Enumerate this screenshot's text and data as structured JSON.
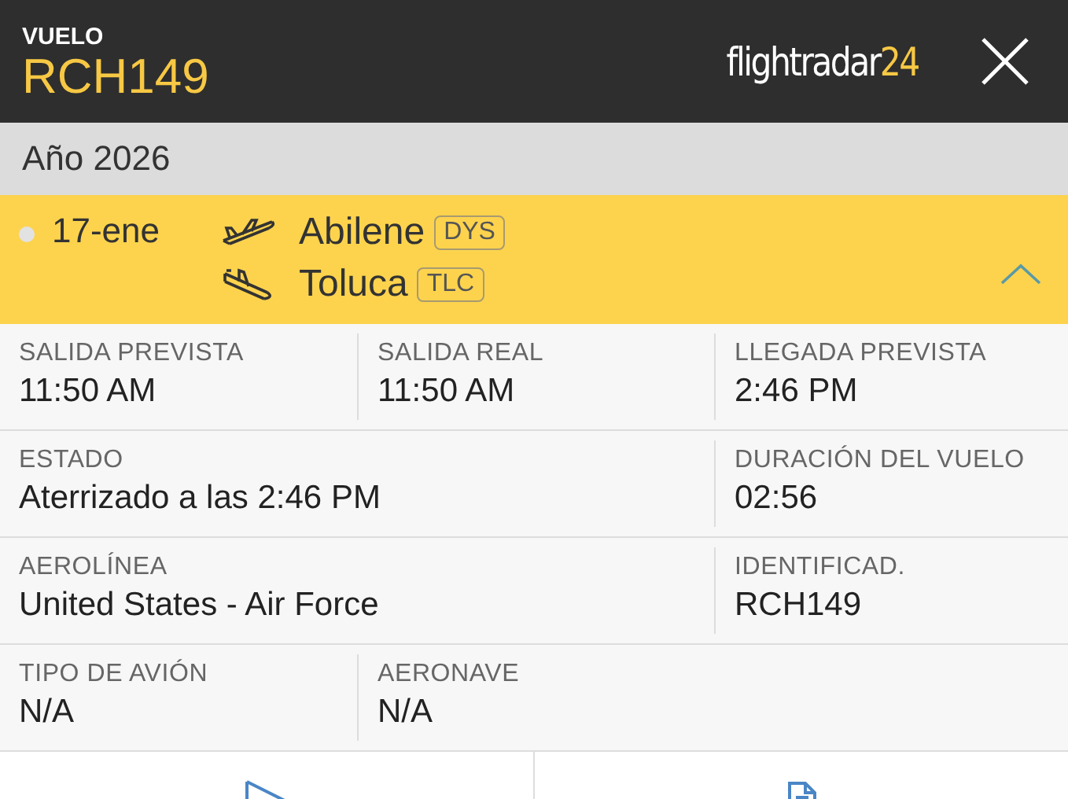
{
  "header": {
    "label": "VUELO",
    "flight": "RCH149",
    "logo_text": "flightradar",
    "logo_accent": "24"
  },
  "year_bar": "Año 2026",
  "flight_row": {
    "date": "17-ene",
    "expanded": true,
    "legs": [
      {
        "kind": "departure",
        "city": "Abilene",
        "code": "DYS"
      },
      {
        "kind": "arrival",
        "city": "Toluca",
        "code": "TLC"
      }
    ]
  },
  "details": [
    {
      "kind": "even",
      "cells": [
        {
          "label": "SALIDA PREVISTA",
          "value": "11:50 AM"
        },
        {
          "label": "SALIDA REAL",
          "value": "11:50 AM"
        },
        {
          "label": "LLEGADA PREVISTA",
          "value": "2:46 PM"
        }
      ]
    },
    {
      "kind": "wide",
      "cells": [
        {
          "label": "ESTADO",
          "value": "Aterrizado a las 2:46 PM"
        },
        {
          "label": "DURACIÓN DEL VUELO",
          "value": "02:56"
        }
      ]
    },
    {
      "kind": "wide",
      "cells": [
        {
          "label": "AEROLÍNEA",
          "value": "United States - Air Force"
        },
        {
          "label": "IDENTIFICAD.",
          "value": "RCH149"
        }
      ]
    },
    {
      "kind": "even",
      "cells": [
        {
          "label": "TIPO DE AVIÓN",
          "value": "N/A"
        },
        {
          "label": "AERONAVE",
          "value": "N/A"
        }
      ]
    }
  ],
  "bottom_buttons": [
    {
      "kind": "route"
    },
    {
      "kind": "document"
    }
  ]
}
